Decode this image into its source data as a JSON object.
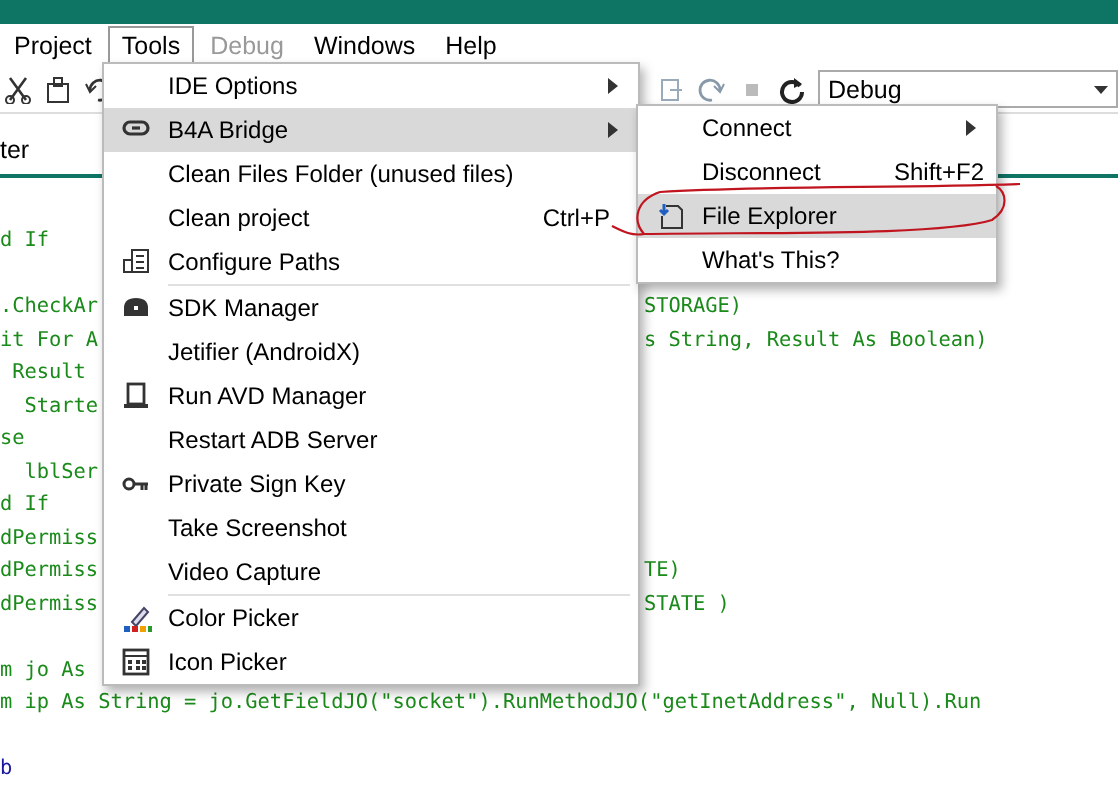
{
  "menu_bar": [
    {
      "label": "Project",
      "selected": false,
      "disabled": false
    },
    {
      "label": "Tools",
      "selected": true,
      "disabled": false
    },
    {
      "label": "Debug",
      "selected": false,
      "disabled": true
    },
    {
      "label": "Windows",
      "selected": false,
      "disabled": false
    },
    {
      "label": "Help",
      "selected": false,
      "disabled": false
    }
  ],
  "toolbar": {
    "configuration": "Debug"
  },
  "tab_label": "ter",
  "code_lines": [
    {
      "kind": "code",
      "left": "d If"
    },
    {
      "kind": "code"
    },
    {
      "kind": "code",
      "left": ".CheckAr",
      "right": "STORAGE)"
    },
    {
      "kind": "code",
      "left": "it For A",
      "right": "s String, Result As Boolean)"
    },
    {
      "kind": "code",
      "left": " Result"
    },
    {
      "kind": "code",
      "left": "  Starte"
    },
    {
      "kind": "code",
      "left": "se"
    },
    {
      "kind": "code",
      "left": "  lblSer"
    },
    {
      "kind": "code",
      "left": "d If"
    },
    {
      "kind": "code",
      "left": "dPermiss"
    },
    {
      "kind": "code",
      "left": "dPermiss",
      "right": "TE)"
    },
    {
      "kind": "code",
      "left": "dPermiss",
      "right": "STATE )"
    },
    {
      "kind": "code"
    },
    {
      "kind": "code",
      "left": "m jo As"
    },
    {
      "kind": "code",
      "left": "m ip As String = jo.GetFieldJO(\"socket\").RunMethodJO(\"getInetAddress\", Null).Run"
    },
    {
      "kind": "code"
    },
    {
      "kind": "keyword",
      "left": "b"
    }
  ],
  "tools_menu": [
    {
      "kind": "item",
      "label": "IDE Options",
      "submenu": true,
      "selected": false
    },
    {
      "kind": "item",
      "label": "B4A Bridge",
      "submenu": true,
      "selected": true
    },
    {
      "kind": "item",
      "label": "Clean Files Folder (unused files)",
      "submenu": false,
      "selected": false
    },
    {
      "kind": "item",
      "label": "Clean project",
      "shortcut": "Ctrl+P",
      "submenu": false,
      "selected": false
    },
    {
      "kind": "item",
      "label": "Configure Paths",
      "submenu": false,
      "selected": false
    },
    {
      "kind": "separator"
    },
    {
      "kind": "item",
      "label": "SDK Manager",
      "submenu": false,
      "selected": false
    },
    {
      "kind": "item",
      "label": "Jetifier (AndroidX)",
      "submenu": false,
      "selected": false
    },
    {
      "kind": "item",
      "label": "Run AVD Manager",
      "submenu": false,
      "selected": false
    },
    {
      "kind": "item",
      "label": "Restart ADB Server",
      "submenu": false,
      "selected": false
    },
    {
      "kind": "item",
      "label": "Private Sign Key",
      "submenu": false,
      "selected": false
    },
    {
      "kind": "item",
      "label": "Take Screenshot",
      "submenu": false,
      "selected": false
    },
    {
      "kind": "item",
      "label": "Video Capture",
      "submenu": false,
      "selected": false
    },
    {
      "kind": "separator"
    },
    {
      "kind": "item",
      "label": "Color Picker",
      "submenu": false,
      "selected": false
    },
    {
      "kind": "item",
      "label": "Icon Picker",
      "submenu": false,
      "selected": false
    }
  ],
  "bridge_submenu": [
    {
      "kind": "item",
      "label": "Connect",
      "submenu": true,
      "selected": false
    },
    {
      "kind": "item",
      "label": "Disconnect",
      "shortcut": "Shift+F2",
      "submenu": false,
      "selected": false
    },
    {
      "kind": "item",
      "label": "File Explorer",
      "submenu": false,
      "selected": true
    },
    {
      "kind": "item",
      "label": "What's This?",
      "submenu": false,
      "selected": false
    }
  ]
}
